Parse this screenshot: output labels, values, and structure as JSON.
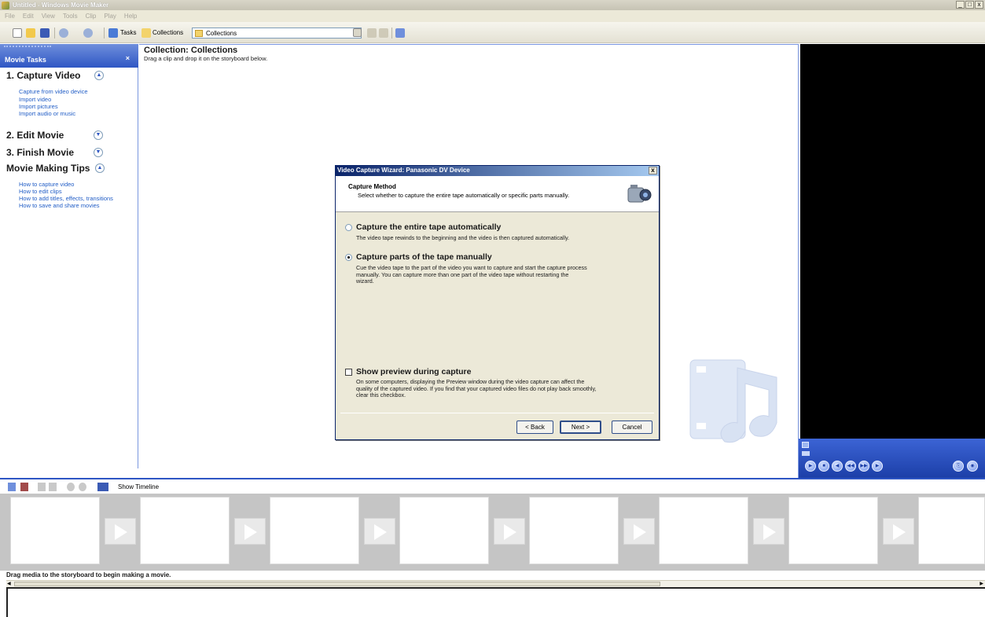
{
  "window": {
    "title": "Untitled - Windows Movie Maker",
    "controls": [
      "_",
      "□",
      "x"
    ]
  },
  "menu": [
    "File",
    "Edit",
    "View",
    "Tools",
    "Clip",
    "Play",
    "Help"
  ],
  "toolbar": {
    "tasks_label": "Tasks",
    "collections_label": "Collections",
    "collections_value": "Collections"
  },
  "taskpane": {
    "header": "Movie Tasks",
    "close": "×",
    "sections": [
      {
        "title": "1. Capture Video",
        "links": [
          "Capture from video device",
          "Import video",
          "Import pictures",
          "Import audio or music"
        ]
      },
      {
        "title": "2. Edit Movie",
        "links": []
      },
      {
        "title": "3. Finish Movie",
        "links": []
      },
      {
        "title": "Movie Making Tips",
        "links": [
          "How to capture video",
          "How to edit clips",
          "How to add titles, effects, transitions",
          "How to save and share movies"
        ]
      }
    ]
  },
  "collection": {
    "title": "Collection: Collections",
    "subtitle": "Drag a clip and drop it on the storyboard below."
  },
  "storyboard": {
    "show_timeline": "Show Timeline",
    "status": "Drag media to the storyboard to begin making a movie."
  },
  "dialog": {
    "title": "Video Capture Wizard: Panasonic DV Device",
    "close": "x",
    "heading": "Capture Method",
    "subheading": "Select whether to capture the entire tape automatically or specific parts manually.",
    "options": [
      {
        "title": "Capture the entire tape automatically",
        "desc": "The video tape rewinds to the beginning and the video is then captured automatically.",
        "selected": false
      },
      {
        "title": "Capture parts of the tape manually",
        "desc": "Cue the video tape to the part of the video you want to capture and start the capture process manually. You can capture more than one part of the video tape without restarting the wizard.",
        "selected": true
      }
    ],
    "preview": {
      "title": "Show preview during capture",
      "desc": "On some computers, displaying the Preview window during the video capture can affect the quality of the captured video. If you find that your captured video files do not play back smoothly, clear this checkbox.",
      "checked": false
    },
    "buttons": {
      "back": "< Back",
      "next": "Next >",
      "cancel": "Cancel"
    }
  },
  "colors": {
    "accent": "#2e56c4",
    "title_gradient_start": "#0a246a",
    "link": "#215dc6"
  }
}
